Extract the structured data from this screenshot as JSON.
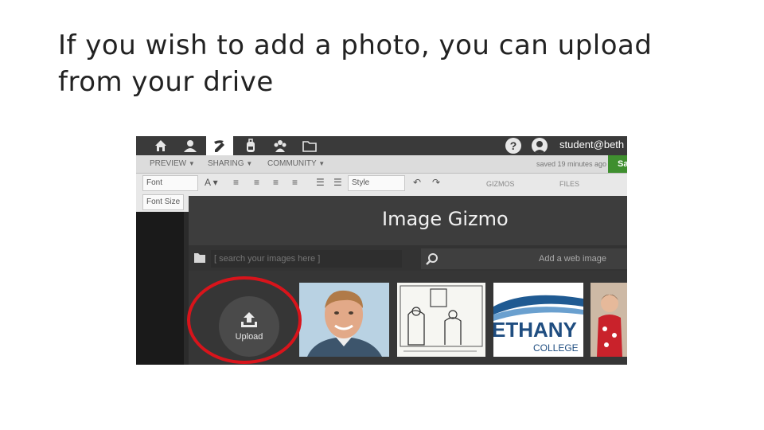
{
  "slide": {
    "title": "If you wish to add a photo, you can upload from your drive"
  },
  "app": {
    "nav_icons": [
      "home-icon",
      "user-icon",
      "edit-icon",
      "backpack-icon",
      "group-icon",
      "folder-icon"
    ],
    "help_label": "?",
    "user_email": "student@beth",
    "menu": [
      "PREVIEW",
      "SHARING",
      "COMMUNITY"
    ],
    "saved_status": "saved 19 minutes ago",
    "save_label": "Sa",
    "toolbar": {
      "font_label": "Font",
      "font_size_label": "Font Size",
      "style_label": "Style",
      "gizmos_label": "GIZMOS",
      "files_label": "FILES"
    }
  },
  "modal": {
    "title": "Image Gizmo",
    "search_placeholder": "[ search your images here ]",
    "web_image_label": "Add a web image",
    "upload_label": "Upload",
    "thumbnails": [
      "portrait-photo",
      "cartoon-drawing",
      "bethany-college-logo",
      "child-photo"
    ],
    "logo_text": "ETHANY",
    "logo_subtext": "COLLEGE"
  },
  "colors": {
    "highlight_ring": "#d8141b",
    "save_button": "#3f8f2f",
    "modal_bg": "#363636"
  }
}
